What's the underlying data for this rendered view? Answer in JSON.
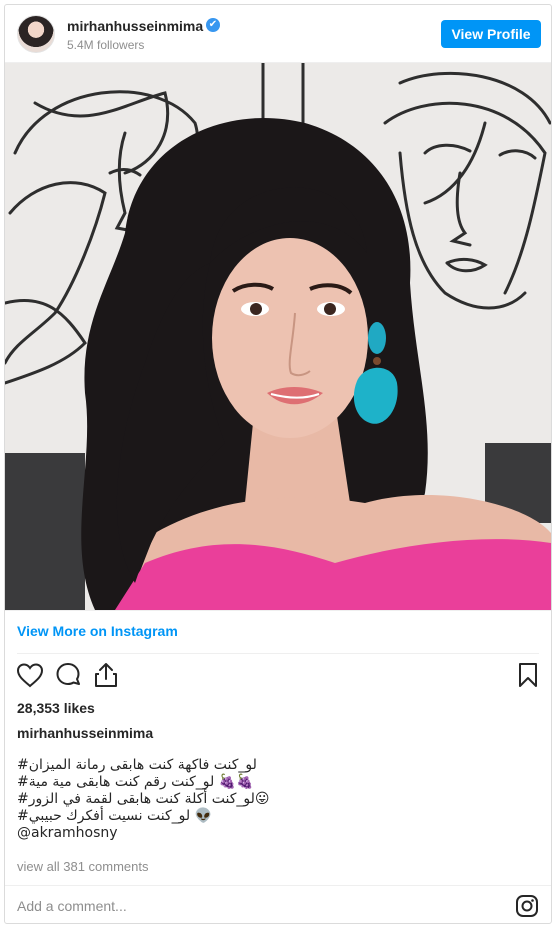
{
  "header": {
    "username": "mirhanhusseinmima",
    "verified_mark": "✔",
    "followers": "5.4M followers",
    "view_profile_label": "View Profile"
  },
  "post": {
    "image_alt": "selfie photo",
    "view_more_label": "View More on Instagram",
    "likes": "28,353 likes",
    "caption_user": "mirhanhusseinmima",
    "caption_lines": [
      "لو_كنت فاكهة كنت هابقى رمانة الميزان#",
      "🍇🍇 لو_كنت رقم كنت هابقى مية مية#",
      "😛لو_كنت أكلة كنت هابقى لقمة في الزور#",
      "👽 لو_كنت نسيت أفكرك حبيبي#"
    ],
    "mention": "@akramhosny",
    "comments_label": "view all 381 comments"
  },
  "actions": {
    "icons": [
      "heart-icon",
      "comment-icon",
      "share-icon",
      "bookmark-icon"
    ]
  },
  "comment_box": {
    "placeholder": "Add a comment..."
  },
  "colors": {
    "accent": "#0095f6",
    "verified": "#3897f0",
    "text": "#262626",
    "muted": "#8e8e8e",
    "border": "#dbdbdb"
  }
}
